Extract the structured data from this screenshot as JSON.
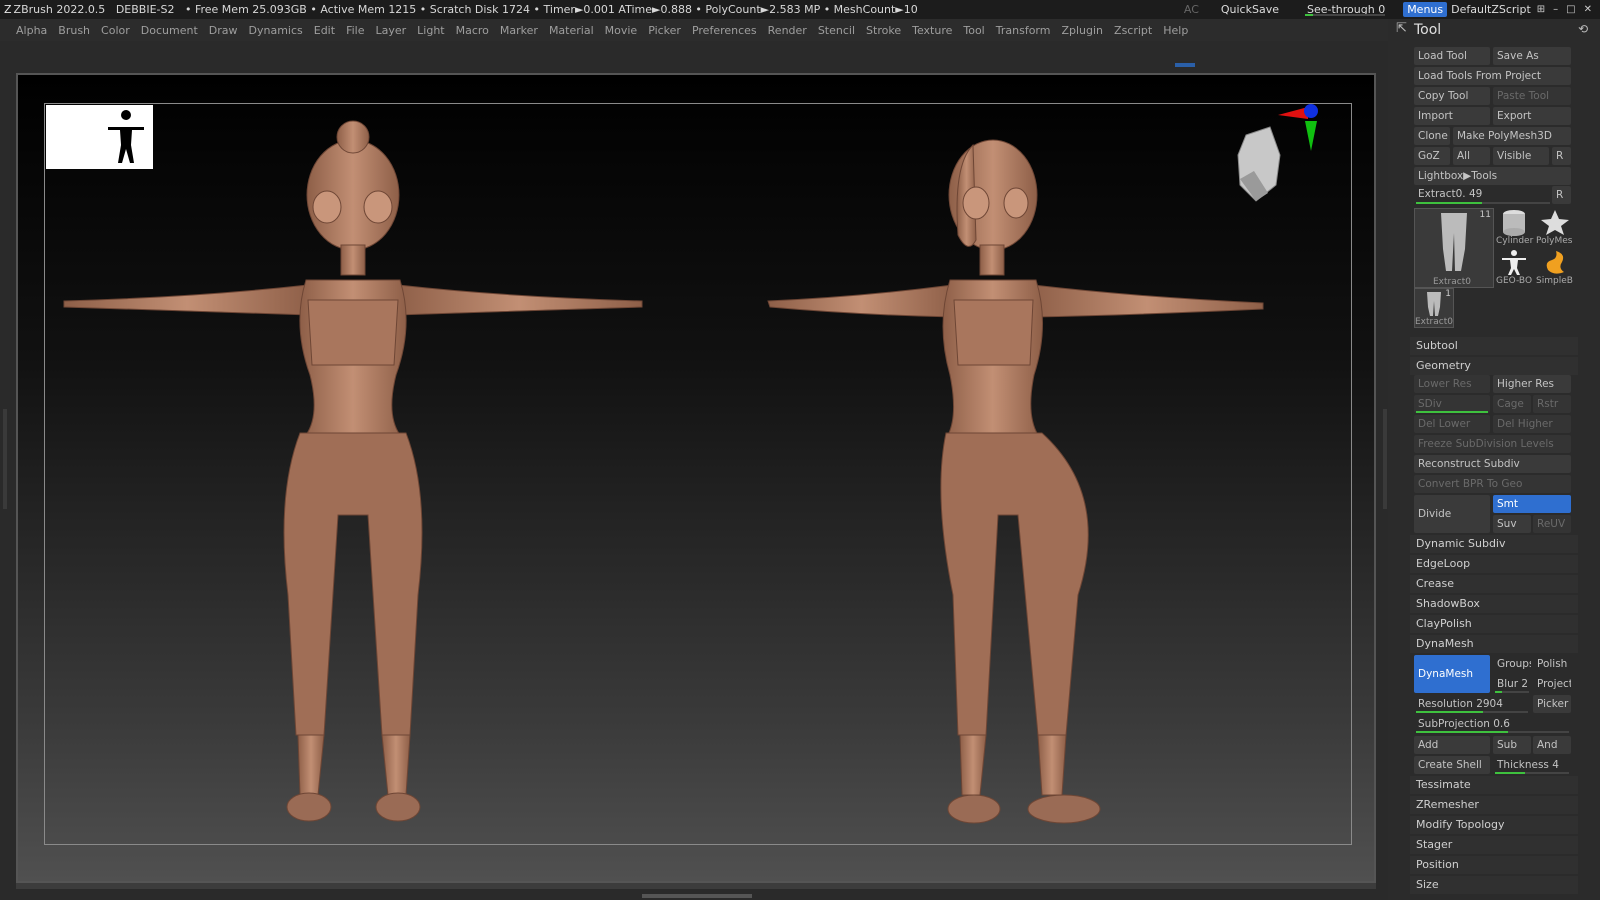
{
  "titlebar": {
    "app": "ZBrush 2022.0.5",
    "doc": "DEBBIE-S2",
    "stats": "• Free Mem 25.093GB • Active Mem 1215 • Scratch Disk 1724 •  Timer►0.001 ATime►0.888 • PolyCount►2.583 MP  • MeshCount►10",
    "ac": "AC",
    "quicksave": "QuickSave",
    "seethrough": "See-through   0",
    "menus": "Menus",
    "script": "DefaultZScript"
  },
  "menubar": [
    "Alpha",
    "Brush",
    "Color",
    "Document",
    "Draw",
    "Dynamics",
    "Edit",
    "File",
    "Layer",
    "Light",
    "Macro",
    "Marker",
    "Material",
    "Movie",
    "Picker",
    "Preferences",
    "Render",
    "Stencil",
    "Stroke",
    "Texture",
    "Tool",
    "Transform",
    "Zplugin",
    "Zscript",
    "Help"
  ],
  "tool": {
    "title": "Tool",
    "load_tool": "Load Tool",
    "save_as": "Save As",
    "load_from_project": "Load Tools From Project",
    "copy_tool": "Copy Tool",
    "paste_tool": "Paste Tool",
    "import": "Import",
    "export": "Export",
    "clone": "Clone",
    "make_polymesh": "Make PolyMesh3D",
    "goz": "GoZ",
    "all": "All",
    "visible": "Visible",
    "r": "R",
    "lightbox_tools": "Lightbox▶Tools",
    "extract_slider": "Extract0. 49",
    "r2": "R",
    "tiles": [
      {
        "label": "Extract0",
        "count": "11"
      },
      {
        "label": "Cylinder",
        "count": ""
      },
      {
        "label": "PolyMes",
        "count": ""
      },
      {
        "label": "GEO-BO",
        "count": ""
      },
      {
        "label": "SimpleB",
        "count": ""
      },
      {
        "label": "Extract0",
        "count": "1"
      }
    ],
    "subtool": "Subtool",
    "geometry": "Geometry",
    "lower_res": "Lower Res",
    "higher_res": "Higher Res",
    "sdiv": "SDiv",
    "cage": "Cage",
    "rstr": "Rstr",
    "del_lower": "Del Lower",
    "del_higher": "Del Higher",
    "freeze": "Freeze SubDivision Levels",
    "reconstruct": "Reconstruct Subdiv",
    "convert_bpr": "Convert BPR To Geo",
    "divide": "Divide",
    "smt": "Smt",
    "suv": "Suv",
    "reuv": "ReUV",
    "dynamic_subdiv": "Dynamic Subdiv",
    "edgeloop": "EdgeLoop",
    "crease": "Crease",
    "shadowbox": "ShadowBox",
    "claypolish": "ClayPolish",
    "dynamesh_section": "DynaMesh",
    "dynamesh_btn": "DynaMesh",
    "groups": "Groups",
    "polish": "Polish",
    "blur": "Blur 2",
    "project": "Project",
    "resolution": "Resolution 2904",
    "picker": "Picker",
    "subprojection": "SubProjection 0.6",
    "add": "Add",
    "sub": "Sub",
    "and": "And",
    "create_shell": "Create Shell",
    "thickness": "Thickness 4",
    "tessimate": "Tessimate",
    "zremesher": "ZRemesher",
    "modify_topology": "Modify Topology",
    "stager": "Stager",
    "position": "Position",
    "size": "Size"
  },
  "colors": {
    "accent_blue": "#2f6fd0",
    "skin": "#b98468",
    "slider_green": "#3ec13e"
  },
  "sliders": {
    "seethrough": 0.1,
    "extract": 0.49,
    "sdiv": 1.0,
    "blur": 0.2,
    "resolution": 0.6,
    "subprojection": 0.6,
    "thickness": 0.4
  }
}
